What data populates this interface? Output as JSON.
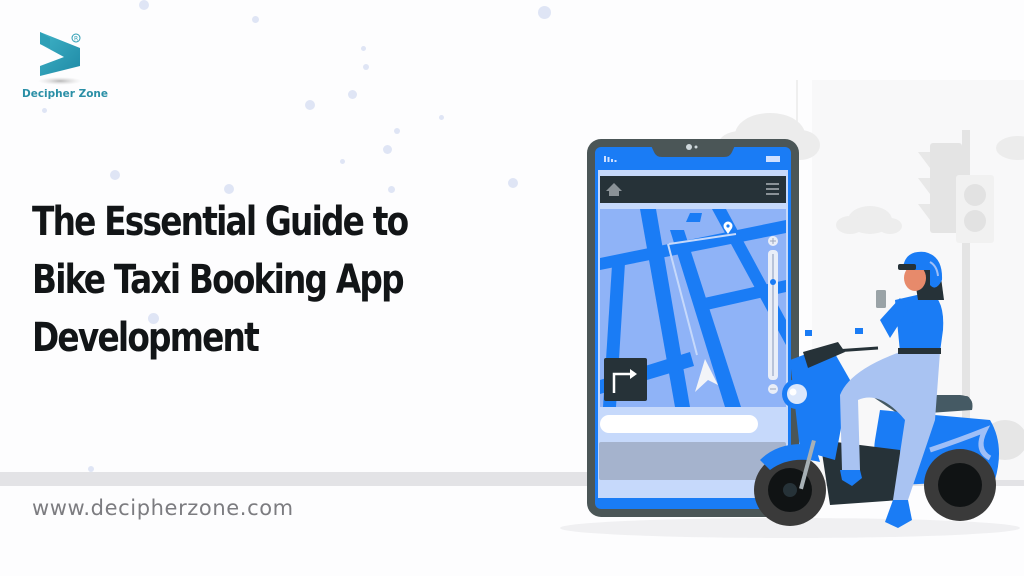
{
  "brand": {
    "name": "Decipher Zone",
    "registered_mark": "®",
    "color": "#2a9cb3"
  },
  "headline": {
    "lines": [
      "The Essential Guide to",
      "Bike Taxi Booking App",
      "Development"
    ]
  },
  "footer": {
    "url": "www.decipherzone.com"
  },
  "illustration": {
    "subject": "woman-on-scooter-with-phone-navigation-app",
    "phone_icons": [
      "signal-icon",
      "battery-icon",
      "home-icon",
      "menu-icon",
      "location-pin-icon",
      "zoom-in-icon",
      "zoom-out-icon",
      "turn-right-icon",
      "navigation-arrow-icon"
    ],
    "colors": {
      "primary_blue": "#1a7cf5",
      "map_light": "#8fb3f7",
      "dark": "#263238",
      "pants": "#a9c3f2"
    }
  }
}
